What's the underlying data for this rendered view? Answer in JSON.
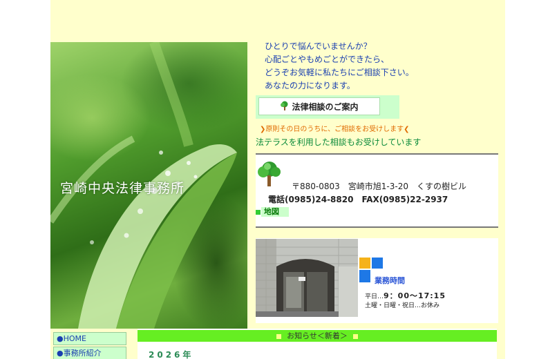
{
  "hero": {
    "title": "宮崎中央法律事務所"
  },
  "intro": {
    "lines": [
      "ひとりで悩んでいませんか？",
      "心配ごとやもめごとができたら、",
      "どうぞお気軽に私たちにご相談下さい。",
      "あなたの力になります。"
    ]
  },
  "consult": {
    "button_label": "法律相談のご案内",
    "note_same_day": "❯原則その日のうちに、ご相談をお受けします❮",
    "note_houterasu": "法テラスを利用した相談もお受けしています"
  },
  "contact": {
    "address": "〒880-0803　宮崎市旭1-3-20　くすの樹ビル",
    "phone": "電話(0985)24-8820　FAX(0985)22-2937",
    "map_label": "地図"
  },
  "hours": {
    "title": "業務時間",
    "weekday_prefix": "平日…",
    "weekday_time": "9：00〜17:15",
    "holiday": "土曜・日曜・祝日…お休み"
  },
  "nav": {
    "items": [
      {
        "label": "●HOME"
      },
      {
        "label": "●事務所紹介"
      }
    ]
  },
  "news": {
    "header": "お知らせ＜新着＞",
    "year": "2026年"
  },
  "colors": {
    "page_bg": "#ffffcc",
    "intro_text": "#1a3fb0",
    "accent_green": "#66ee22",
    "note_orange": "#e06a00"
  }
}
